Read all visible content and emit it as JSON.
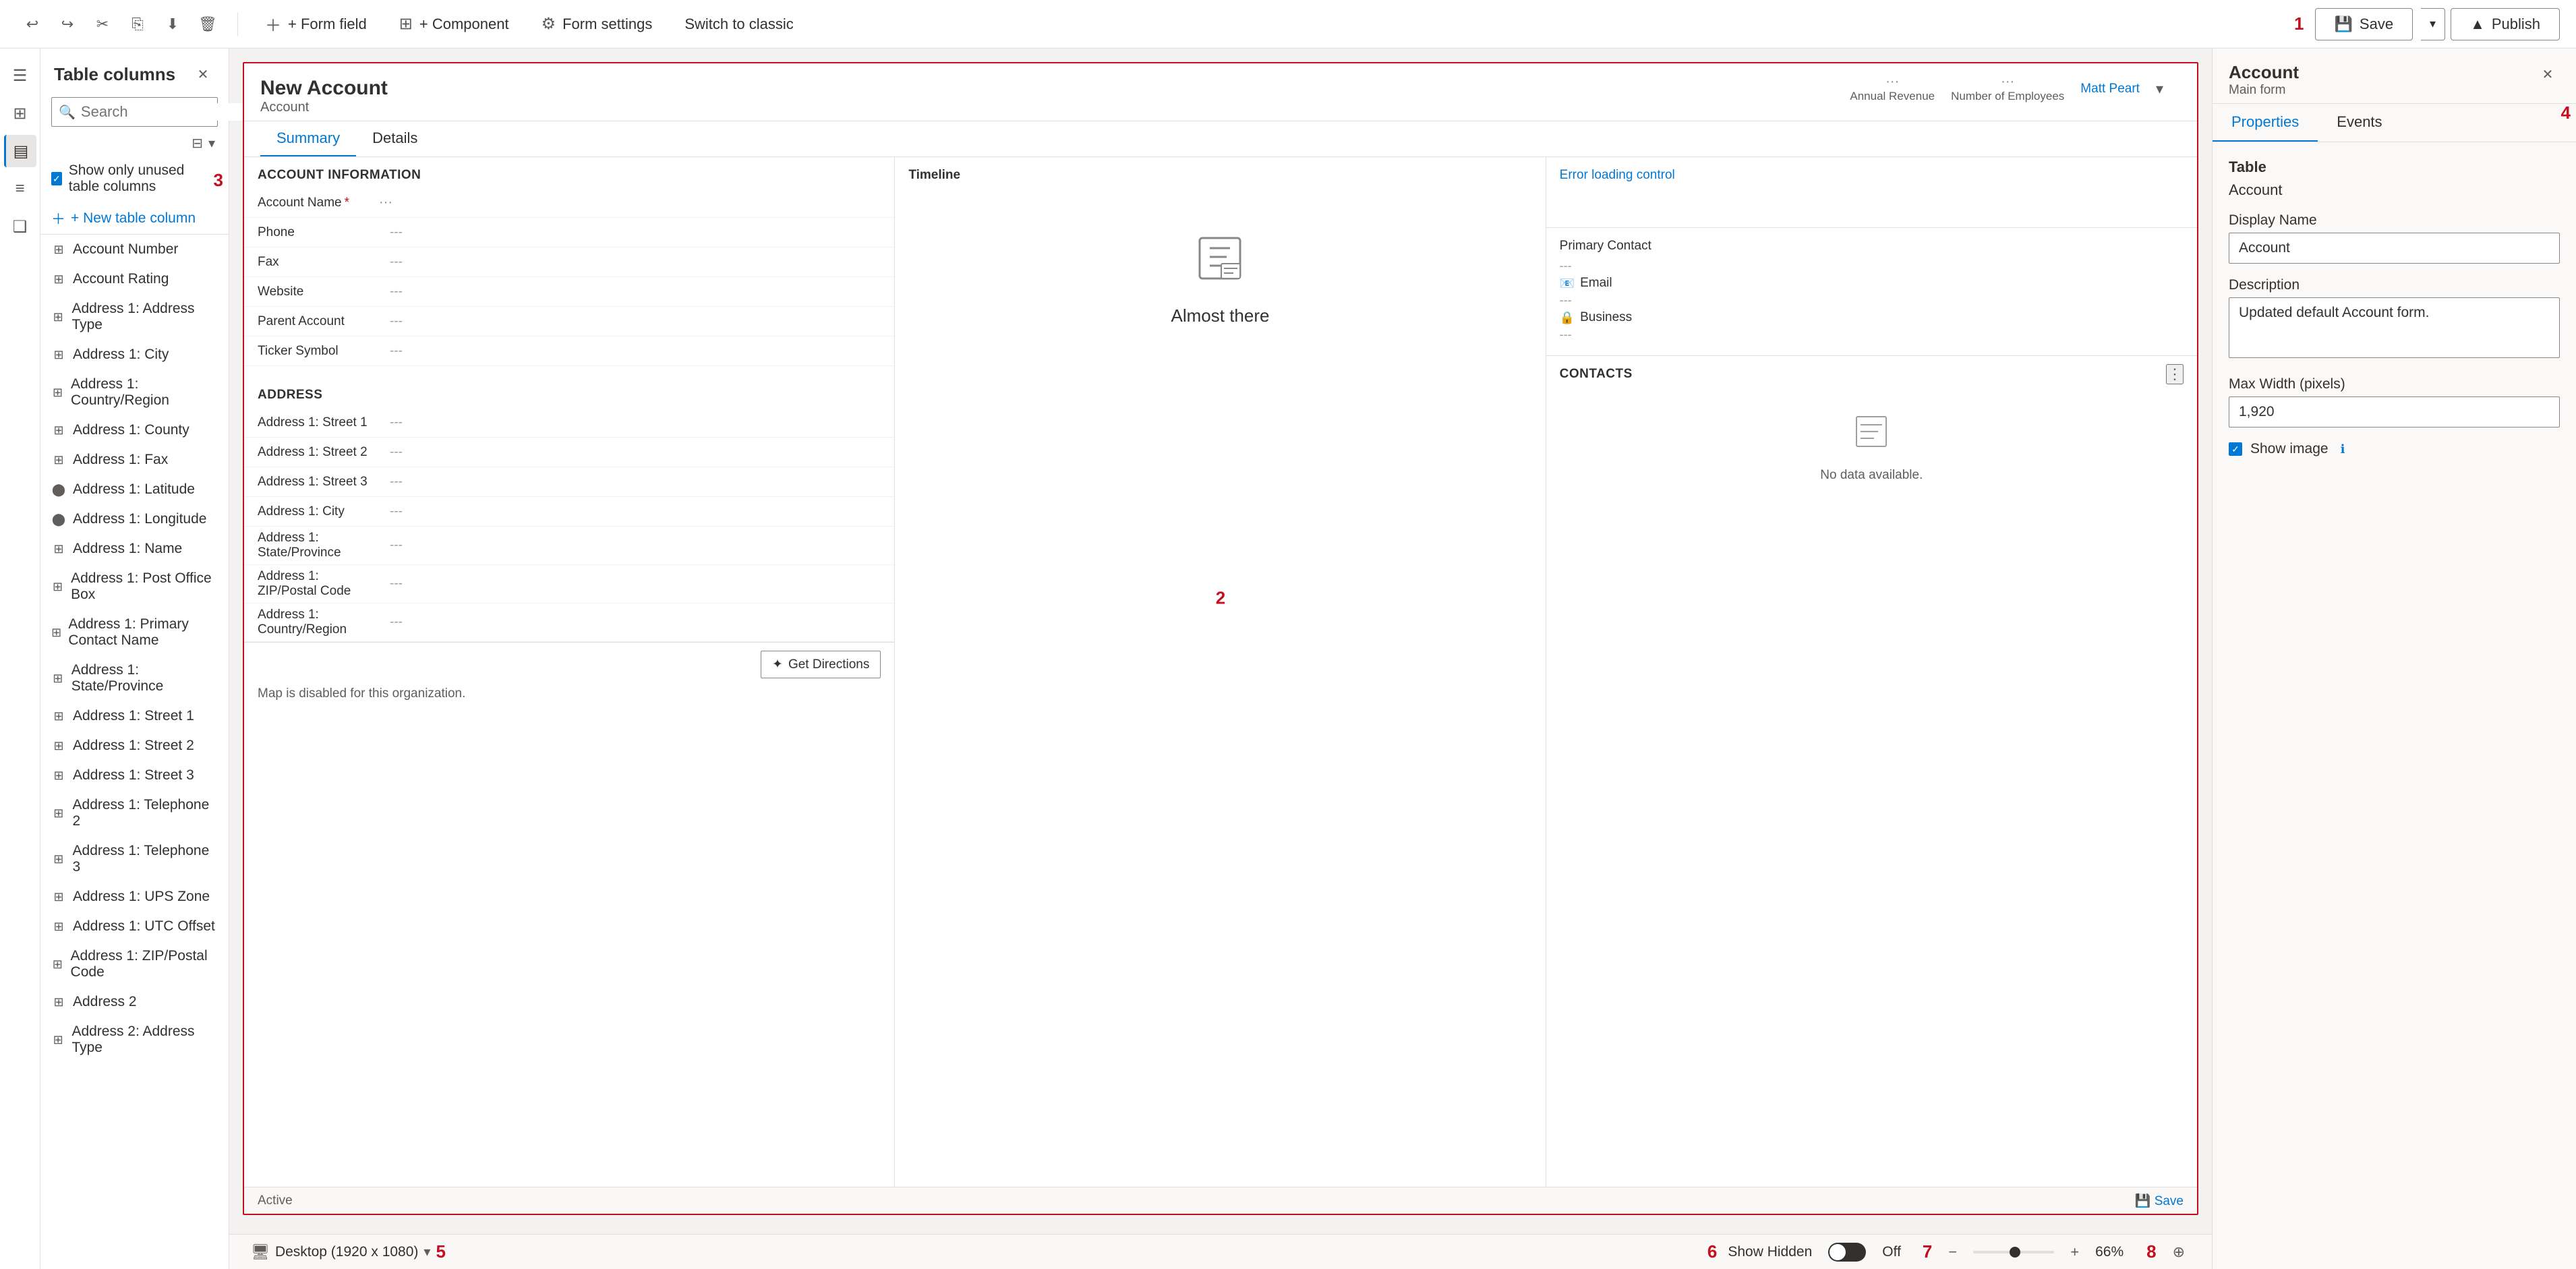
{
  "toolbar": {
    "undo_tooltip": "Undo",
    "redo_tooltip": "Redo",
    "cut_tooltip": "Cut",
    "copy_tooltip": "Copy",
    "paste_tooltip": "Paste",
    "delete_tooltip": "Delete",
    "form_field_label": "+ Form field",
    "component_label": "+ Component",
    "form_settings_label": "Form settings",
    "switch_classic_label": "Switch to classic",
    "save_label": "Save",
    "publish_label": "Publish"
  },
  "left_panel": {
    "title": "Table columns",
    "search_placeholder": "Search",
    "new_column_label": "+ New table column",
    "unused_toggle_label": "Show only unused table columns",
    "columns": [
      {
        "name": "Account Number",
        "icon": "grid"
      },
      {
        "name": "Account Rating",
        "icon": "grid"
      },
      {
        "name": "Address 1: Address Type",
        "icon": "grid"
      },
      {
        "name": "Address 1: City",
        "icon": "grid"
      },
      {
        "name": "Address 1: Country/Region",
        "icon": "grid"
      },
      {
        "name": "Address 1: County",
        "icon": "grid"
      },
      {
        "name": "Address 1: Fax",
        "icon": "grid"
      },
      {
        "name": "Address 1: Latitude",
        "icon": "circle"
      },
      {
        "name": "Address 1: Longitude",
        "icon": "circle"
      },
      {
        "name": "Address 1: Name",
        "icon": "grid"
      },
      {
        "name": "Address 1: Post Office Box",
        "icon": "grid"
      },
      {
        "name": "Address 1: Primary Contact Name",
        "icon": "grid"
      },
      {
        "name": "Address 1: State/Province",
        "icon": "grid"
      },
      {
        "name": "Address 1: Street 1",
        "icon": "grid"
      },
      {
        "name": "Address 1: Street 2",
        "icon": "grid"
      },
      {
        "name": "Address 1: Street 3",
        "icon": "grid"
      },
      {
        "name": "Address 1: Telephone 2",
        "icon": "grid"
      },
      {
        "name": "Address 1: Telephone 3",
        "icon": "grid"
      },
      {
        "name": "Address 1: UPS Zone",
        "icon": "grid"
      },
      {
        "name": "Address 1: UTC Offset",
        "icon": "grid"
      },
      {
        "name": "Address 1: ZIP/Postal Code",
        "icon": "grid"
      },
      {
        "name": "Address 2",
        "icon": "grid"
      },
      {
        "name": "Address 2: Address Type",
        "icon": "grid"
      }
    ]
  },
  "form_preview": {
    "title": "New Account",
    "subtitle": "Account",
    "header_cols": [
      {
        "label": "Annual Revenue",
        "dots": "···"
      },
      {
        "label": "Number of Employees",
        "dots": "···"
      }
    ],
    "owner_label": "Matt Peart",
    "tabs": [
      "Summary",
      "Details"
    ],
    "active_tab": "Summary",
    "sections": {
      "account_info": {
        "title": "ACCOUNT INFORMATION",
        "fields": [
          {
            "label": "Account Name",
            "required": true,
            "value": "···"
          },
          {
            "label": "Phone",
            "value": "---"
          },
          {
            "label": "Fax",
            "value": "---"
          },
          {
            "label": "Website",
            "value": "---"
          },
          {
            "label": "Parent Account",
            "value": "---"
          },
          {
            "label": "Ticker Symbol",
            "value": "---"
          }
        ]
      },
      "address": {
        "title": "ADDRESS",
        "fields": [
          {
            "label": "Address 1: Street 1",
            "value": "---"
          },
          {
            "label": "Address 1: Street 2",
            "value": "---"
          },
          {
            "label": "Address 1: Street 3",
            "value": "---"
          },
          {
            "label": "Address 1: City",
            "value": "---"
          },
          {
            "label": "Address 1: State/Province",
            "value": "---"
          },
          {
            "label": "Address 1: ZIP/Postal Code",
            "value": "---"
          },
          {
            "label": "Address 1: Country/Region",
            "value": "---"
          }
        ]
      },
      "timeline_title": "Timeline",
      "almost_there": "Almost there",
      "error_loading": "Error loading control",
      "primary_contact_title": "Primary Contact",
      "email_label": "Email",
      "business_label": "Business",
      "contacts_title": "CONTACTS",
      "no_data_text": "No data available.",
      "get_directions_label": "Get Directions",
      "map_disabled_text": "Map is disabled for this organization.",
      "status_active": "Active",
      "status_save": "Save"
    }
  },
  "right_panel": {
    "title": "Account",
    "subtitle": "Main form",
    "tabs": [
      "Properties",
      "Events"
    ],
    "active_tab": "Properties",
    "properties": {
      "table_label": "Table",
      "table_value": "Account",
      "display_name_label": "Display Name",
      "display_name_value": "Account",
      "description_label": "Description",
      "description_value": "Updated default Account form.",
      "max_width_label": "Max Width (pixels)",
      "max_width_value": "1,920",
      "show_image_label": "Show image"
    }
  },
  "bottom_bar": {
    "desktop_label": "Desktop (1920 x 1080)",
    "show_hidden_label": "Show Hidden",
    "toggle_state": "Off",
    "zoom_value": "66%"
  },
  "red_labels": {
    "label1": "1",
    "label2": "2",
    "label3": "3",
    "label4": "4",
    "label5": "5",
    "label6": "6",
    "label7": "7",
    "label8": "8"
  }
}
